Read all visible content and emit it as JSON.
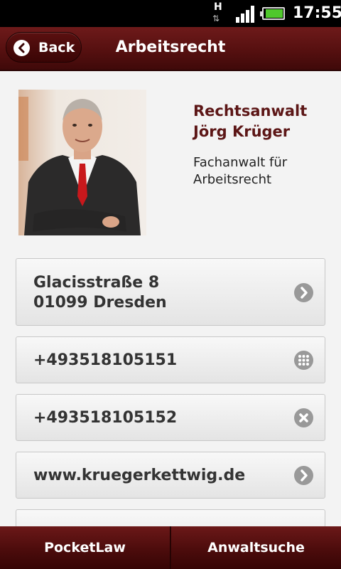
{
  "status_bar": {
    "network_type": "H",
    "time": "17:55",
    "battery_level": 0.85
  },
  "header": {
    "back_label": "Back",
    "title": "Arbeitsrecht"
  },
  "profile": {
    "name_line1": "Rechtsanwalt",
    "name_line2": "Jörg Krüger",
    "specialty_line1": "Fachanwalt für",
    "specialty_line2": "Arbeitsrecht"
  },
  "contacts": [
    {
      "lines": [
        "Glacisstraße 8",
        "01099 Dresden"
      ],
      "icon": "chevron-right-icon"
    },
    {
      "lines": [
        "+493518105151"
      ],
      "icon": "keypad-icon"
    },
    {
      "lines": [
        "+493518105152"
      ],
      "icon": "close-icon"
    },
    {
      "lines": [
        "www.kruegerkettwig.de"
      ],
      "icon": "chevron-right-icon"
    }
  ],
  "tabs": {
    "left": "PocketLaw",
    "right": "Anwaltsuche"
  },
  "colors": {
    "header": "#561010",
    "accent_text": "#5c1616",
    "status_bar": "#000000"
  }
}
